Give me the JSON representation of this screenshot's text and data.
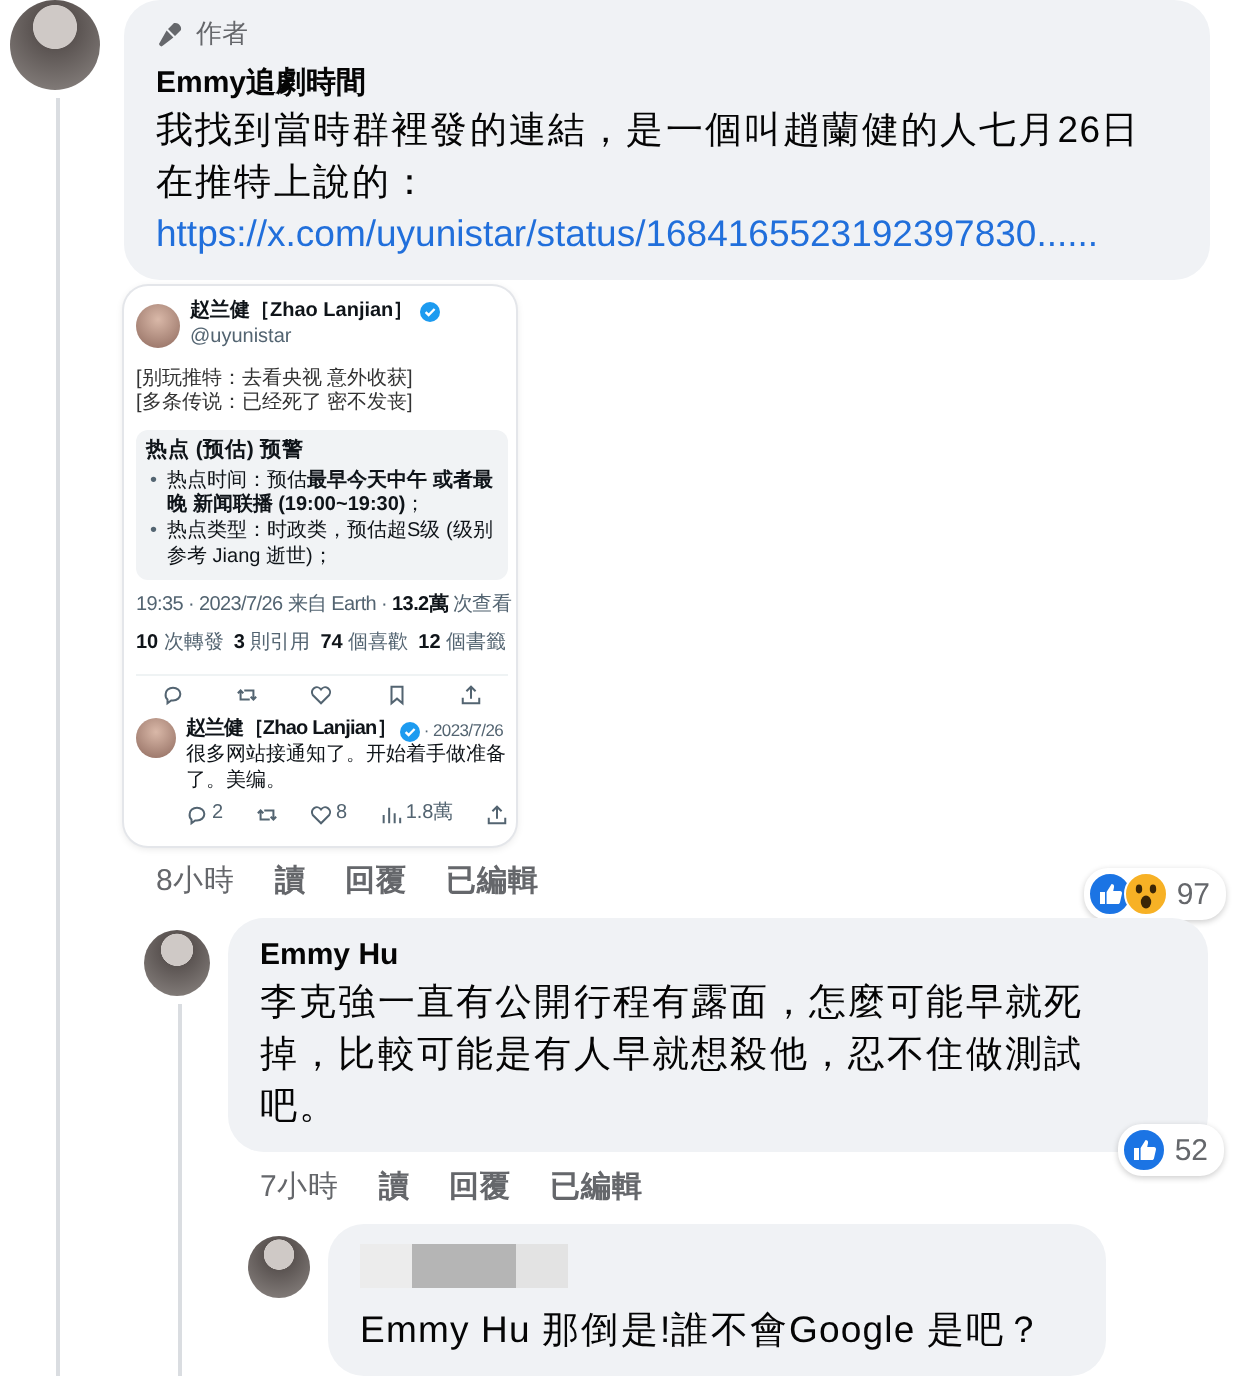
{
  "comments": [
    {
      "author": "Emmy追劇時間",
      "author_hidden": false,
      "badge": "作者",
      "text": "我找到當時群裡發的連結，是一個叫趙蘭健的人七月26日在推特上說的：",
      "link": "https://x.com/uyunistar/status/1684165523192397830......",
      "attachment": {
        "kind": "tweet",
        "name": "赵兰健［Zhao Lanjian］",
        "handle": "@uyunistar",
        "lines": [
          "[别玩推特：去看央视 意外收获]",
          "[多条传说：已经死了 密不发丧]"
        ],
        "box_title": "热点 (预估) 预警",
        "bullet_marker": "•",
        "bullets": [
          "热点时间：预估**最早今天中午 或者最晚 新闻联播 (19:00~19:30)**；",
          "热点类型：时政类，预估超S级 (级别参考 Jiang 逝世)；"
        ],
        "meta": "19:35 · 2023/7/26 来自 Earth · **13.2萬** 次查看",
        "stats": [
          {
            "count": "10",
            "label": "次轉發"
          },
          {
            "count": "3",
            "label": "則引用"
          },
          {
            "count": "74",
            "label": "個喜歡"
          },
          {
            "count": "12",
            "label": "個書籤"
          }
        ],
        "reply": {
          "name": "赵兰健［Zhao Lanjian］",
          "date": "· 2023/7/26",
          "text": "很多网站接通知了。开始着手做准备了。美编。",
          "replies": "2",
          "likes": "8",
          "views": "1.8萬"
        }
      },
      "time": "8小時",
      "actions": [
        "讀",
        "回覆",
        "已編輯"
      ],
      "reactions": [
        {
          "kind": "like"
        },
        {
          "kind": "wow"
        }
      ],
      "reaction_count": "97",
      "replies": [
        {
          "author": "Emmy Hu",
          "author_hidden": false,
          "text": "李克強一直有公開行程有露面，怎麼可能早就死掉，比較可能是有人早就想殺他，忍不住做測試吧。",
          "time": "7小時",
          "actions": [
            "讀",
            "回覆",
            "已編輯"
          ],
          "reactions": [
            {
              "kind": "like"
            }
          ],
          "reaction_count": "52",
          "replies": [
            {
              "author_hidden": true,
              "text": "Emmy Hu 那倒是!誰不會Google 是吧？"
            }
          ]
        }
      ]
    }
  ]
}
